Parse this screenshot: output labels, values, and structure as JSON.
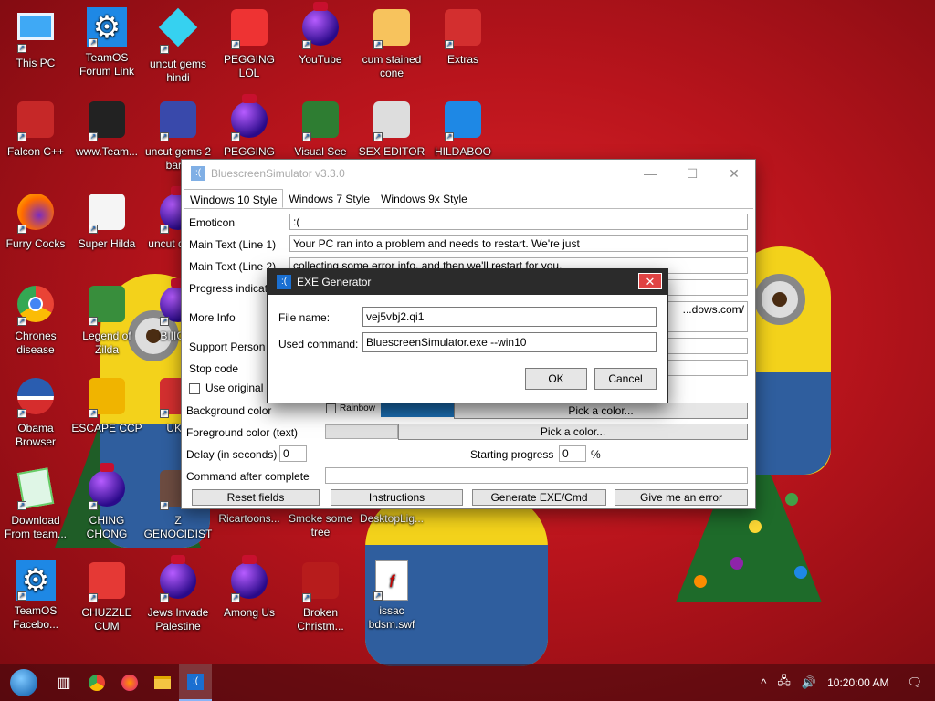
{
  "desktop": {
    "icons": [
      {
        "label": "This PC",
        "icon": "monitor-icon"
      },
      {
        "label": "TeamOS Forum Link",
        "icon": "gear-icon"
      },
      {
        "label": "uncut gems hindi",
        "icon": "diamond-icon"
      },
      {
        "label": "PEGGING LOL",
        "icon": "p-logo-icon"
      },
      {
        "label": "YouTube",
        "icon": "ball-icon"
      },
      {
        "label": "cum stained cone",
        "icon": "cone-icon"
      },
      {
        "label": "Extras",
        "icon": "gift-icon"
      },
      {
        "label": "Falcon C++",
        "icon": "ornament-icon"
      },
      {
        "label": "www.Team...",
        "icon": "drive-icon"
      },
      {
        "label": "uncut gems 2 bar...",
        "icon": "number-two-icon"
      },
      {
        "label": "PEGGING",
        "icon": "ball-icon"
      },
      {
        "label": "Visual See",
        "icon": "csharp-icon"
      },
      {
        "label": "SEX EDITOR",
        "icon": "hex-editor-icon"
      },
      {
        "label": "HILDABOO",
        "icon": "snake-icon"
      },
      {
        "label": "Furry Cocks",
        "icon": "firefox-icon"
      },
      {
        "label": "Super Hilda",
        "icon": "pixel-dog-icon"
      },
      {
        "label": "uncut delete",
        "icon": "ball-icon"
      },
      {
        "label": "Chrones disease",
        "icon": "chrome-icon"
      },
      {
        "label": "Legend of Zilda",
        "icon": "zelda-icon"
      },
      {
        "label": "BIIIG C",
        "icon": "ball-icon"
      },
      {
        "label": "Obama Browser",
        "icon": "obama-logo-icon"
      },
      {
        "label": "ESCAPE CCP",
        "icon": "escape-icon"
      },
      {
        "label": "UKR",
        "icon": "radiation-icon"
      },
      {
        "label": "Download From team...",
        "icon": "notepad-icon"
      },
      {
        "label": "CHING CHONG",
        "icon": "ball-icon"
      },
      {
        "label": "Z GENOCIDIST",
        "icon": "z-icon"
      },
      {
        "label": "Ricartoons...",
        "icon": "blank-icon"
      },
      {
        "label": "Smoke some tree",
        "icon": "blank-icon"
      },
      {
        "label": "DesktopLig...",
        "icon": "blank-icon"
      },
      {
        "label": "TeamOS Facebo...",
        "icon": "gear-icon"
      },
      {
        "label": "CHUZZLE CUM",
        "icon": "chuzzle-icon"
      },
      {
        "label": "Jews Invade Palestine",
        "icon": "ball-icon"
      },
      {
        "label": "Among Us",
        "icon": "ball-icon"
      },
      {
        "label": "Broken Christm...",
        "icon": "christmas-ball-icon"
      },
      {
        "label": "issac bdsm.swf",
        "icon": "swf-file-icon"
      }
    ]
  },
  "main_window": {
    "title": "BluescreenSimulator v3.3.0",
    "tabs": [
      "Windows 10 Style",
      "Windows 7 Style",
      "Windows 9x Style"
    ],
    "fields": {
      "emoticon_label": "Emoticon",
      "emoticon_value": ":(",
      "main1_label": "Main Text (Line 1)",
      "main1_value": "Your PC ran into a problem and needs to restart. We're just",
      "main2_label": "Main Text (Line 2)",
      "main2_value": "collecting some error info, and then we'll restart for you.",
      "progress_label": "Progress indicat...",
      "moreinfo_label": "More Info",
      "moreinfo_value": "...dows.com/",
      "support_label": "Support Person",
      "stopcode_label": "Stop code",
      "use_original_label": "Use original",
      "bgcolor_label": "Background color",
      "rainbow_label": "Rainbow",
      "pick_color_bg": "Pick a color...",
      "fgcolor_label": "Foreground color (text)",
      "pick_color_fg": "Pick a color...",
      "delay_label": "Delay (in seconds)",
      "delay_value": "0",
      "starting_progress_label": "Starting progress",
      "starting_progress_value": "0",
      "percent_sign": "%",
      "command_label": "Command after complete"
    },
    "buttons": {
      "reset": "Reset fields",
      "instructions": "Instructions",
      "generate": "Generate EXE/Cmd",
      "give_error": "Give me an error"
    },
    "colors": {
      "bg_swatch": "#1a6fb5",
      "fg_swatch": "#e0e0e0"
    }
  },
  "exe_dialog": {
    "title": "EXE Generator",
    "file_name_label": "File name:",
    "file_name_value": "vej5vbj2.qi1",
    "used_command_label": "Used command:",
    "used_command_value": "BluescreenSimulator.exe --win10",
    "ok": "OK",
    "cancel": "Cancel",
    "close_glyph": "✕"
  },
  "taskbar": {
    "clock": "10:20:00 AM",
    "items": [
      "start-orb-icon",
      "task-view-icon",
      "chrome-icon",
      "firefox-icon",
      "file-explorer-icon",
      "bluescreen-app-icon"
    ]
  }
}
